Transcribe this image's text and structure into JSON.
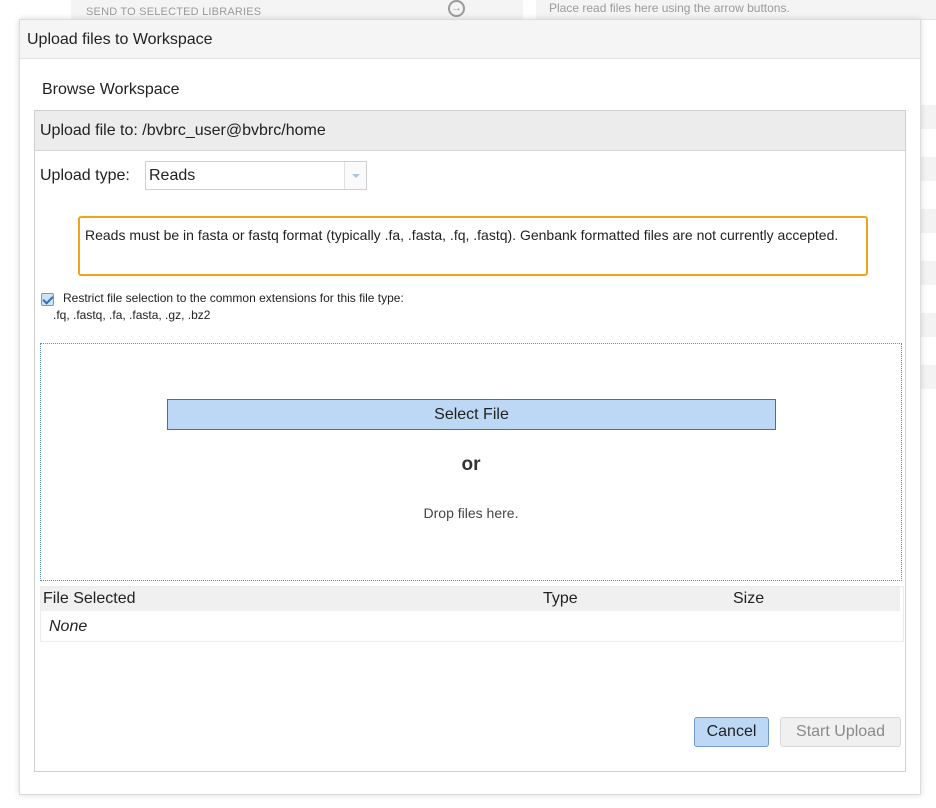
{
  "background": {
    "left_bar_text": "SEND TO SELECTED LIBRARIES",
    "right_bar_text": "Place read files here using the arrow buttons."
  },
  "dialog": {
    "title": "Upload files to Workspace",
    "browse_label": "Browse Workspace",
    "upload_to_label": "Upload file to: /bvbrc_user@bvbrc/home",
    "upload_type_label": "Upload type:",
    "upload_type_value": "Reads",
    "notice": "Reads must be in fasta or fastq format (typically .fa, .fasta, .fq, .fastq). Genbank formatted files are not currently accepted.",
    "restrict_label": "Restrict file selection to the common extensions for this file type:",
    "restrict_checked": true,
    "extensions": ".fq, .fastq, .fa, .fasta, .gz, .bz2",
    "select_file_label": "Select File",
    "or_label": "or",
    "drop_label": "Drop files here.",
    "table": {
      "columns": [
        "File Selected",
        "Type",
        "Size"
      ],
      "empty_label": "None"
    },
    "cancel_label": "Cancel",
    "start_upload_label": "Start Upload"
  },
  "colors": {
    "notice_border": "#f0a31c",
    "primary_button": "#bcd8f4",
    "drop_zone_border": "#5a8fc4"
  },
  "icons": {
    "background_arrow": "arrow-right-circle-icon",
    "select_dropdown": "chevron-down-icon",
    "checkbox": "checkmark-icon"
  }
}
